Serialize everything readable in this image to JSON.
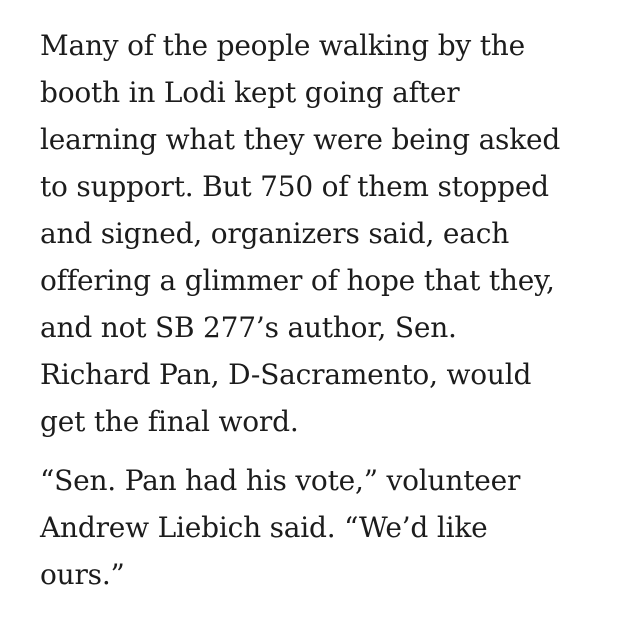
{
  "article": {
    "paragraph_1": {
      "lines": [
        "Many of the people walking by the",
        "booth in Lodi kept going after",
        "learning what they were being asked",
        "to support. But 750 of them stopped",
        "and signed, organizers said, each",
        "offering a glimmer of hope that they,",
        "and not SB 277’s author, Sen.",
        "Richard Pan, D-Sacramento, would",
        "get the final word."
      ]
    },
    "paragraph_2": {
      "lines": [
        "“Sen. Pan had his vote,” volunteer",
        "Andrew Liebich said. “We’d like",
        "ours.”"
      ]
    }
  }
}
